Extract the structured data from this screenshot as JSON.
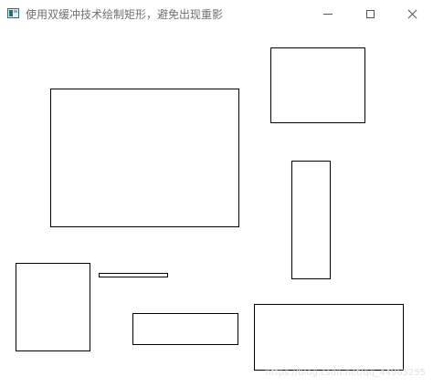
{
  "window": {
    "title": "使用双缓冲技术绘制矩形，避免出现重影",
    "icon": "app-window-icon",
    "controls": {
      "minimize_icon": "minimize-icon",
      "maximize_icon": "maximize-icon",
      "close_icon": "close-icon"
    }
  },
  "canvas": {
    "background": "#ffffff",
    "stroke_color": "#000000",
    "rectangle_count": 7
  },
  "watermark": {
    "text": "https://blog.csdn.net/qq_44965255"
  }
}
